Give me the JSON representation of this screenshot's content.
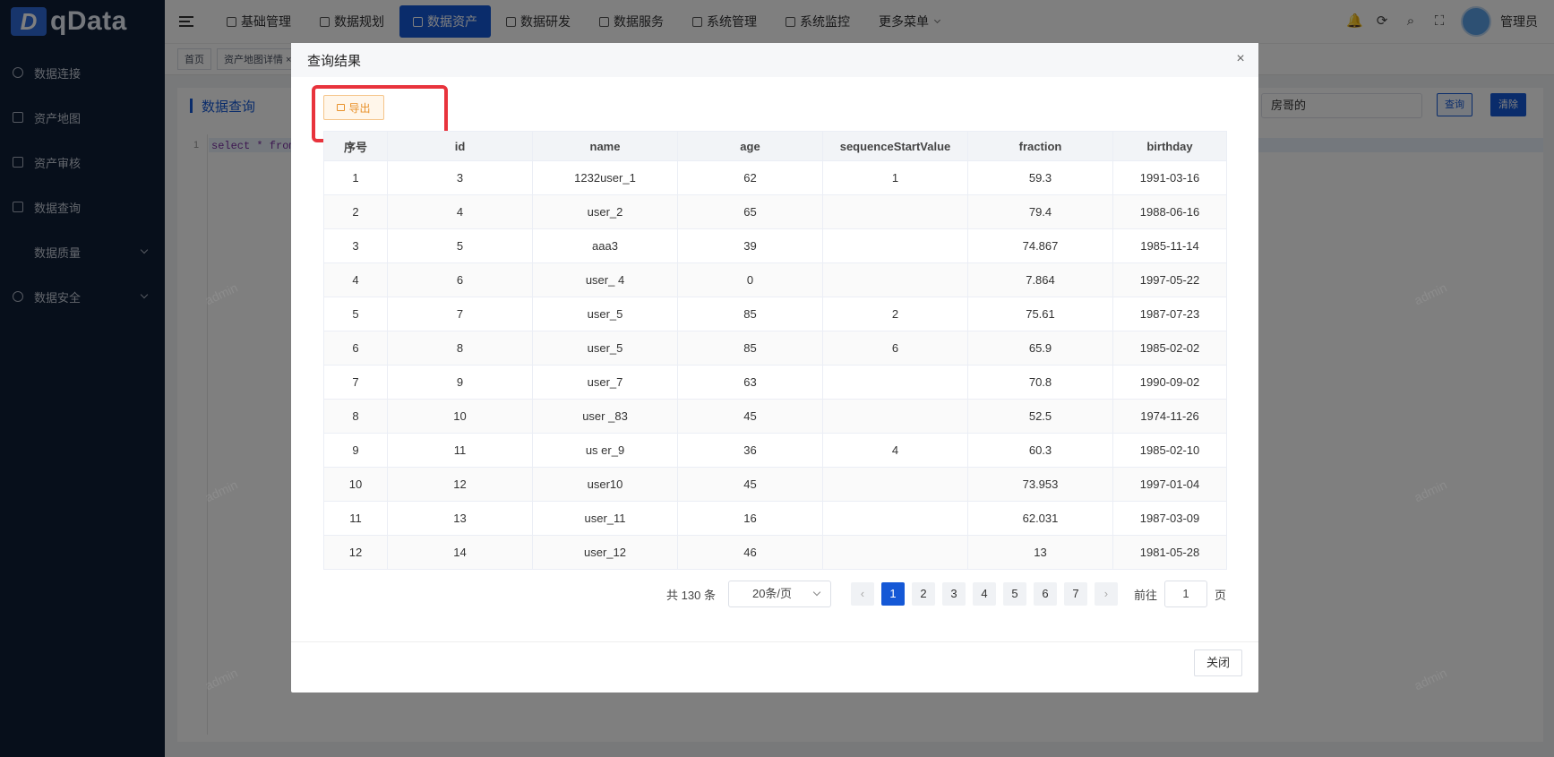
{
  "logo": {
    "mark": "D",
    "text": "qData"
  },
  "sidebar": {
    "items": [
      {
        "label": "数据连接",
        "icon": "connection-icon"
      },
      {
        "label": "资产地图",
        "icon": "map-icon"
      },
      {
        "label": "资产审核",
        "icon": "audit-icon"
      },
      {
        "label": "数据查询",
        "icon": "query-icon"
      },
      {
        "label": "数据质量",
        "icon": ""
      },
      {
        "label": "数据安全",
        "icon": "shield-icon"
      }
    ]
  },
  "topnav": {
    "items": [
      {
        "label": "基础管理"
      },
      {
        "label": "数据规划"
      },
      {
        "label": "数据资产"
      },
      {
        "label": "数据研发"
      },
      {
        "label": "数据服务"
      },
      {
        "label": "系统管理"
      },
      {
        "label": "系统监控"
      },
      {
        "label": "更多菜单"
      }
    ],
    "active_index": 2,
    "username": "管理员"
  },
  "tabs": {
    "items": [
      {
        "label": "首页"
      },
      {
        "label": "资产地图详情 ×"
      }
    ]
  },
  "content": {
    "title": "数据查询",
    "datasource_value": "房哥的",
    "query_label": "查询",
    "clear_label": "清除",
    "line_number": "1",
    "code": "select * from us"
  },
  "watermark": "admin",
  "dialog": {
    "title": "查询结果",
    "close_icon": "×",
    "export_label": "导出",
    "columns": [
      "序号",
      "id",
      "name",
      "age",
      "sequenceStartValue",
      "fraction",
      "birthday"
    ],
    "rows": [
      [
        "1",
        "3",
        "1232user_1",
        "62",
        "1",
        "59.3",
        "1991-03-16"
      ],
      [
        "2",
        "4",
        "user_2",
        "65",
        "",
        "79.4",
        "1988-06-16"
      ],
      [
        "3",
        "5",
        "aaa3",
        "39",
        "",
        "74.867",
        "1985-11-14"
      ],
      [
        "4",
        "6",
        "user_ 4",
        "0",
        "",
        "7.864",
        "1997-05-22"
      ],
      [
        "5",
        "7",
        "user_5",
        "85",
        "2",
        "75.61",
        "1987-07-23"
      ],
      [
        "6",
        "8",
        "user_5",
        "85",
        "6",
        "65.9",
        "1985-02-02"
      ],
      [
        "7",
        "9",
        "user_7",
        "63",
        "",
        "70.8",
        "1990-09-02"
      ],
      [
        "8",
        "10",
        "user _83",
        "45",
        "",
        "52.5",
        "1974-11-26"
      ],
      [
        "9",
        "11",
        "us er_9",
        "36",
        "4",
        "60.3",
        "1985-02-10"
      ],
      [
        "10",
        "12",
        "user10",
        "45",
        "",
        "73.953",
        "1997-01-04"
      ],
      [
        "11",
        "13",
        "user_11",
        "16",
        "",
        "62.031",
        "1987-03-09"
      ],
      [
        "12",
        "14",
        "user_12",
        "46",
        "",
        "13",
        "1981-05-28"
      ]
    ],
    "pagination": {
      "total_text": "共 130 条",
      "page_size": "20条/页",
      "prev": "‹",
      "next": "›",
      "pages": [
        "1",
        "2",
        "3",
        "4",
        "5",
        "6",
        "7"
      ],
      "current": "1",
      "goto_label": "前往",
      "goto_value": "1",
      "page_unit": "页"
    },
    "close_label": "关闭"
  },
  "colors": {
    "primary": "#1558d6",
    "sidebar_bg": "#0f1e36",
    "export_text": "#e8912a",
    "highlight_border": "#e8333c"
  }
}
